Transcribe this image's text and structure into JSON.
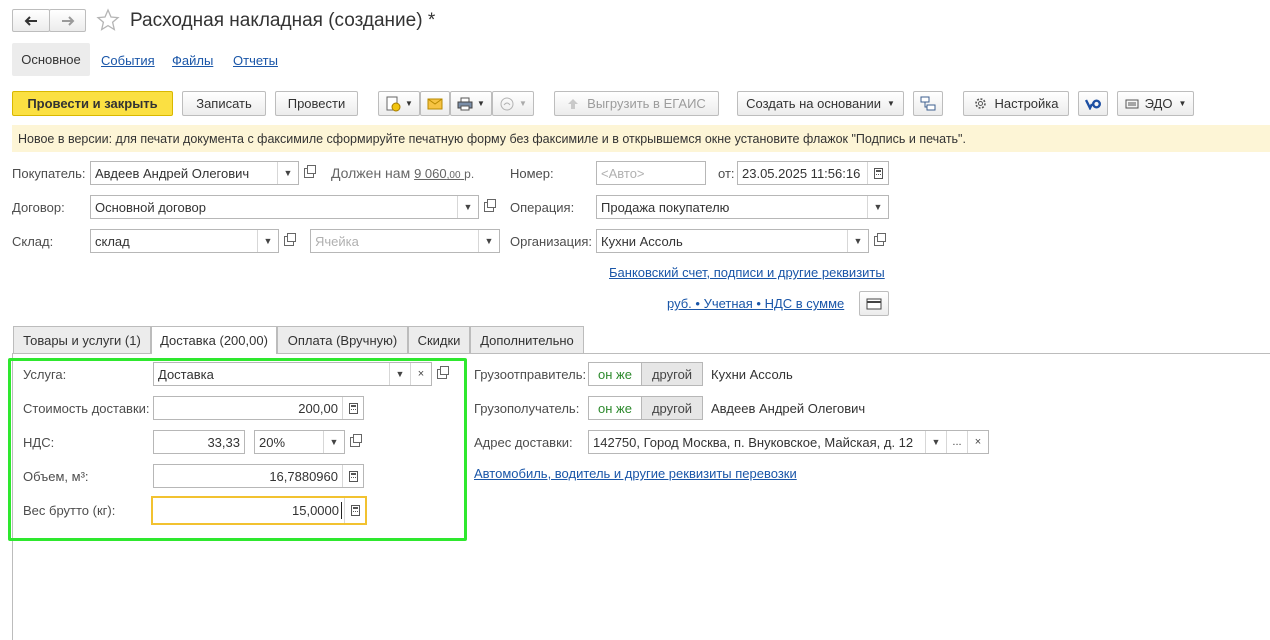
{
  "window": {
    "title": "Расходная накладная (создание) *",
    "back_icon": "arrow-left",
    "forward_icon": "arrow-right",
    "favorite_icon": "star"
  },
  "nav_tabs": [
    "Основное",
    "События",
    "Файлы",
    "Отчеты"
  ],
  "toolbar": {
    "post_close": "Провести и закрыть",
    "save": "Записать",
    "post": "Провести",
    "egais": "Выгрузить в ЕГАИС",
    "create_based": "Создать на основании",
    "settings": "Настройка",
    "edo": "ЭДО"
  },
  "notice": "Новое в версии: для печати документа с факсимиле сформируйте печатную форму без факсимиле и в открывшемся окне установите флажок \"Подпись и печать\".",
  "form": {
    "buyer_label": "Покупатель:",
    "buyer_value": "Авдеев Андрей Олегович",
    "owes_text": "Должен нам",
    "owes_amount": "9 060",
    "owes_cents": ",00",
    "owes_currency": "р.",
    "number_label": "Номер:",
    "number_placeholder": "<Авто>",
    "date_label": "от:",
    "date_value": "23.05.2025 11:56:16",
    "contract_label": "Договор:",
    "contract_value": "Основной договор",
    "operation_label": "Операция:",
    "operation_value": "Продажа покупателю",
    "warehouse_label": "Склад:",
    "warehouse_value": "склад",
    "cell_placeholder": "Ячейка",
    "org_label": "Организация:",
    "org_value": "Кухни Ассоль",
    "bank_link": "Банковский счет, подписи и другие реквизиты",
    "currency_link": "руб. • Учетная • НДС в сумме"
  },
  "tabs": [
    {
      "label": "Товары и услуги (1)"
    },
    {
      "label": "Доставка (200,00)"
    },
    {
      "label": "Оплата (Вручную)"
    },
    {
      "label": "Скидки"
    },
    {
      "label": "Дополнительно"
    }
  ],
  "delivery": {
    "service_label": "Услуга:",
    "service_value": "Доставка",
    "cost_label": "Стоимость доставки:",
    "cost_value": "200,00",
    "vat_label": "НДС:",
    "vat_amount": "33,33",
    "vat_rate": "20%",
    "volume_label": "Объем, м³:",
    "volume_value": "16,7880960",
    "weight_label": "Вес брутто (кг):",
    "weight_value": "15,0000",
    "shipper_label": "Грузоотправитель:",
    "consignee_label": "Грузополучатель:",
    "seg_same": "он же",
    "seg_other": "другой",
    "shipper_value": "Кухни Ассоль",
    "consignee_value": "Авдеев Андрей Олегович",
    "address_label": "Адрес доставки:",
    "address_value": "142750, Город Москва, п. Внуковское, Майская, д. 12",
    "transport_link": "Автомобиль, водитель и другие реквизиты перевозки"
  },
  "colors": {
    "highlight": "#2ee82e",
    "primary_button": "#fbe042",
    "notice_bg": "#fdf5d6",
    "link": "#1a56a8"
  }
}
